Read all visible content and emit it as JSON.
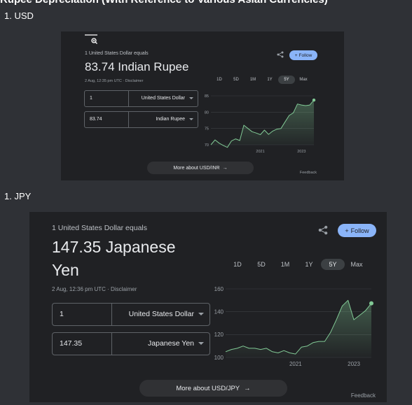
{
  "page": {
    "heading": "Rupee Depreciation (With Reference to Various Asian Currencies)",
    "item1": "1. USD",
    "item2": "1. JPY"
  },
  "cards": [
    {
      "equals_label": "1 United States Dollar equals",
      "converted": "83.74 Indian Rupee",
      "timestamp": "2 Aug, 12:35 pm UTC · Disclaimer",
      "follow_label": "Follow",
      "ranges": [
        "1D",
        "5D",
        "1M",
        "1Y",
        "5Y",
        "Max"
      ],
      "selected_range": "5Y",
      "from_amount": "1",
      "from_currency": "United States Dollar",
      "to_amount": "83.74",
      "to_currency": "Indian Rupee",
      "more_label": "More about USD/INR",
      "feedback": "Feedback",
      "accent": "#8ab4f8"
    },
    {
      "equals_label": "1 United States Dollar equals",
      "converted": "147.35 Japanese Yen",
      "timestamp": "2 Aug, 12:36 pm UTC · Disclaimer",
      "follow_label": "Follow",
      "ranges": [
        "1D",
        "5D",
        "1M",
        "1Y",
        "5Y",
        "Max"
      ],
      "selected_range": "5Y",
      "from_amount": "1",
      "from_currency": "United States Dollar",
      "to_amount": "147.35",
      "to_currency": "Japanese Yen",
      "more_label": "More about USD/JPY",
      "feedback": "Feedback",
      "accent": "#8ab4f8"
    }
  ],
  "chart_data": [
    {
      "type": "area",
      "title": "",
      "xlabel": "",
      "ylabel": "",
      "x_ticks": [
        "2021",
        "2023"
      ],
      "y_ticks": [
        70,
        75,
        80,
        85
      ],
      "ylim": [
        70,
        85
      ],
      "x": [
        2018.6,
        2018.8,
        2019.0,
        2019.2,
        2019.4,
        2019.6,
        2019.8,
        2020.0,
        2020.2,
        2020.4,
        2020.6,
        2020.8,
        2021.0,
        2021.2,
        2021.4,
        2021.6,
        2021.8,
        2022.0,
        2022.2,
        2022.4,
        2022.6,
        2022.8,
        2023.0,
        2023.2,
        2023.4,
        2023.6
      ],
      "values": [
        70.0,
        71.5,
        70.5,
        69.8,
        69.2,
        71.2,
        71.8,
        71.3,
        76.0,
        75.0,
        74.0,
        73.6,
        73.1,
        74.5,
        73.2,
        74.2,
        74.8,
        75.0,
        77.0,
        79.0,
        79.8,
        82.5,
        82.2,
        82.0,
        82.2,
        83.7
      ],
      "line_color": "#81c995",
      "grid": true
    },
    {
      "type": "area",
      "title": "",
      "xlabel": "",
      "ylabel": "",
      "x_ticks": [
        "2021",
        "2023"
      ],
      "y_ticks": [
        100,
        120,
        140,
        160
      ],
      "ylim": [
        100,
        160
      ],
      "x": [
        2018.6,
        2018.8,
        2019.0,
        2019.2,
        2019.4,
        2019.6,
        2019.8,
        2020.0,
        2020.2,
        2020.4,
        2020.6,
        2020.8,
        2021.0,
        2021.2,
        2021.4,
        2021.6,
        2021.8,
        2022.0,
        2022.2,
        2022.4,
        2022.6,
        2022.8,
        2023.0,
        2023.2,
        2023.4,
        2023.6
      ],
      "values": [
        105,
        107,
        108,
        110,
        108,
        108,
        107,
        108,
        105,
        104,
        106,
        104,
        103,
        109,
        110,
        113,
        114,
        114,
        122,
        133,
        145,
        150,
        133,
        137,
        141,
        147.35
      ],
      "line_color": "#81c995",
      "grid": true
    }
  ]
}
